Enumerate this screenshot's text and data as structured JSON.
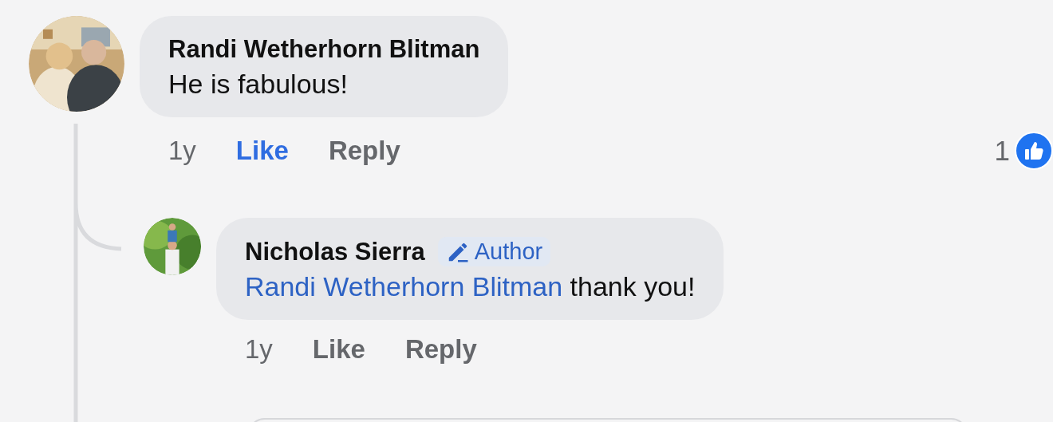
{
  "comments": [
    {
      "author": "Randi Wetherhorn Blitman",
      "text": "He is fabulous!",
      "time": "1y",
      "like": {
        "label": "Like",
        "selected": true
      },
      "reply": "Reply",
      "reaction_count": "1"
    },
    {
      "author": "Nicholas Sierra",
      "badge": "Author",
      "mention": "Randi Wetherhorn Blitman",
      "text": "thank you!",
      "time": "1y",
      "like": {
        "label": "Like",
        "selected": false
      },
      "reply": "Reply"
    }
  ]
}
